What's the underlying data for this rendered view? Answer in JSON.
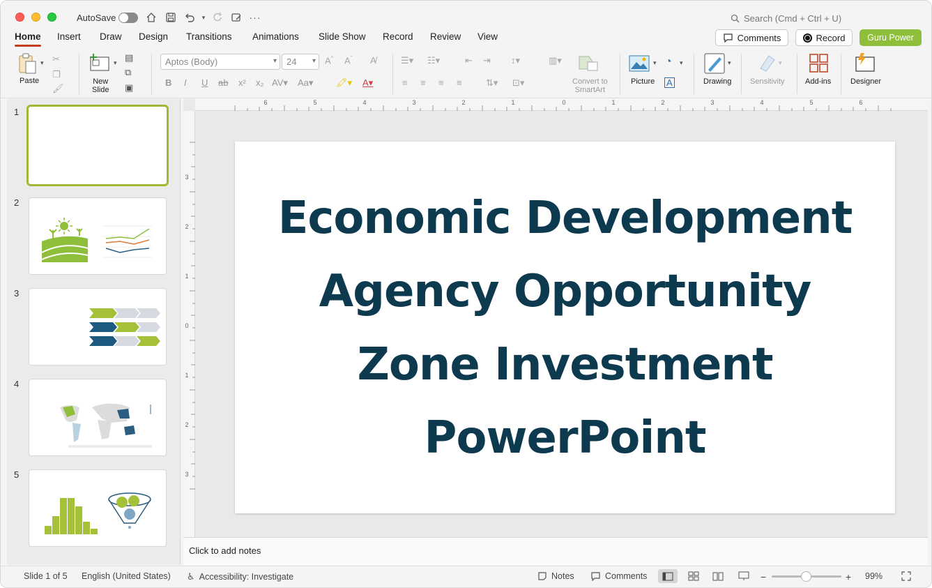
{
  "titlebar": {
    "autosave_label": "AutoSave",
    "search_placeholder": "Search (Cmd + Ctrl + U)"
  },
  "tabs": [
    {
      "label": "Home",
      "active": true
    },
    {
      "label": "Insert"
    },
    {
      "label": "Draw"
    },
    {
      "label": "Design"
    },
    {
      "label": "Transitions"
    },
    {
      "label": "Animations"
    },
    {
      "label": "Slide Show"
    },
    {
      "label": "Record"
    },
    {
      "label": "Review"
    },
    {
      "label": "View"
    }
  ],
  "header_buttons": {
    "comments": "Comments",
    "record": "Record",
    "guru": "Guru Power"
  },
  "ribbon": {
    "paste": "Paste",
    "new_slide": "New\nSlide",
    "font_name": "Aptos (Body)",
    "font_size": "24",
    "convert_smartart": "Convert to\nSmartArt",
    "picture": "Picture",
    "drawing": "Drawing",
    "sensitivity": "Sensitivity",
    "addins": "Add-ins",
    "designer": "Designer"
  },
  "slides": [
    {
      "number": "1"
    },
    {
      "number": "2"
    },
    {
      "number": "3"
    },
    {
      "number": "4"
    },
    {
      "number": "5"
    }
  ],
  "slide": {
    "title": "Economic Development Agency Opportunity Zone Investment PowerPoint"
  },
  "notes_placeholder": "Click to add notes",
  "status": {
    "slide_pos": "Slide 1 of 5",
    "language": "English (United States)",
    "accessibility": "Accessibility: Investigate",
    "notes": "Notes",
    "comments": "Comments",
    "zoom": "99%"
  },
  "colors": {
    "accent_red": "#c43e1c",
    "guru_green": "#8fbf3a",
    "title_navy": "#0e3a50",
    "thumb_selected": "#a5b636"
  }
}
